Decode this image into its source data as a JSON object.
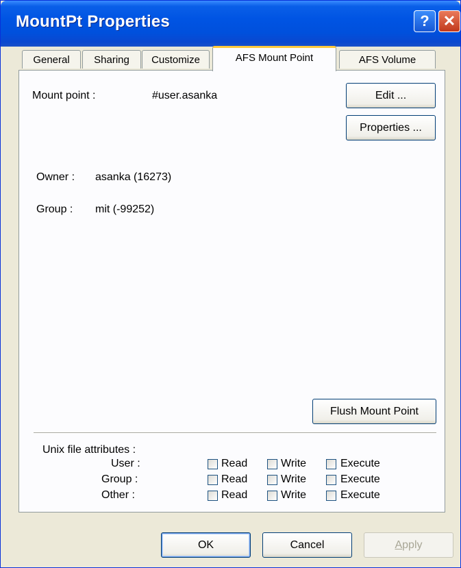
{
  "window": {
    "title": "MountPt Properties",
    "help_glyph": "?",
    "close_glyph": "✕"
  },
  "tabs": [
    {
      "label": "General"
    },
    {
      "label": "Sharing"
    },
    {
      "label": "Customize"
    },
    {
      "label": "AFS Mount Point"
    },
    {
      "label": "AFS Volume"
    }
  ],
  "mount_point": {
    "label": "Mount point :",
    "value": "#user.asanka",
    "edit_button": "Edit ...",
    "properties_button": "Properties ..."
  },
  "owner": {
    "label": "Owner :",
    "value": "asanka (16273)"
  },
  "group": {
    "label": "Group :",
    "value": "mit (-99252)"
  },
  "flush_button": "Flush Mount Point",
  "unix_attributes": {
    "title": "Unix file attributes :",
    "rows": [
      {
        "label": "User :",
        "read": "Read",
        "write": "Write",
        "execute": "Execute"
      },
      {
        "label": "Group :",
        "read": "Read",
        "write": "Write",
        "execute": "Execute"
      },
      {
        "label": "Other :",
        "read": "Read",
        "write": "Write",
        "execute": "Execute"
      }
    ]
  },
  "footer": {
    "ok": "OK",
    "cancel": "Cancel",
    "apply_a": "A",
    "apply_rest": "pply"
  },
  "colors": {
    "title_bar": "#0054e3",
    "tab_highlight": "#ffc83c",
    "dialog_bg": "#ece9d8"
  }
}
